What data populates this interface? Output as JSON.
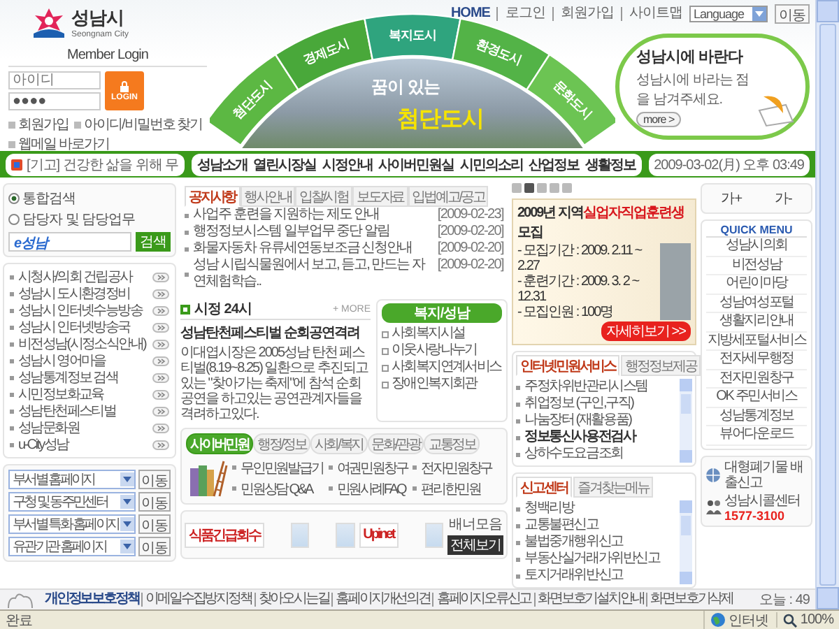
{
  "header": {
    "logo": {
      "name": "성남시",
      "subtitle": "Seongnam City"
    },
    "top_links": [
      "HOME",
      "로그인",
      "회원가입",
      "사이트맵"
    ],
    "language_select": {
      "value": "Language"
    },
    "go_button": "이동"
  },
  "login": {
    "title": "Member Login",
    "id_field": {
      "placeholder": "아이디"
    },
    "password_field": {
      "value": "●●●●"
    },
    "button": "LOGIN",
    "links": [
      "회원가입",
      "아이디/비밀번호 찾기",
      "웹메일 바로가기"
    ]
  },
  "hero": {
    "segments": [
      "첨단도시",
      "경제도시",
      "복지도시",
      "환경도시",
      "문화도시"
    ],
    "slogan": "꿈이 있는",
    "slogan_highlight": "첨단도시"
  },
  "suggestion": {
    "title": "성남시에 바란다",
    "text": "성남시에 바라는 점을 남겨주세요.",
    "button": "more >"
  },
  "nav": {
    "ticker": "[기고] 건강한 삶을 위해 무",
    "menu": [
      "성남소개",
      "열린시장실",
      "시정안내",
      "사이버민원실",
      "시민의소리",
      "산업정보",
      "생활정보"
    ],
    "datetime": "2009-03-02(月) 오후 03:49"
  },
  "search": {
    "options": [
      {
        "label": "통합검색",
        "selected": true
      },
      {
        "label": "담당자 및 담당업무",
        "selected": false
      }
    ],
    "field_logo": "e성남",
    "button": "검색"
  },
  "site_links": [
    "시청사/의회 건립공사",
    "성남시 도시환경정비",
    "성남시 인터넷수능방송",
    "성남시 인터넷방송국",
    "비전성남(시정소식안내)",
    "성남시 영어마을",
    "성남통계정보 검색",
    "시민정보화교육",
    "성남탄천페스티벌",
    "성남문화원",
    "u-City성남"
  ],
  "homepage_selects": [
    {
      "value": "부서별 홈페이지",
      "button": "이동"
    },
    {
      "value": "구청 및 동주민센터",
      "button": "이동"
    },
    {
      "value": "부서별 특화 홈페이지",
      "button": "이동"
    },
    {
      "value": "유관기관 홈페이지",
      "button": "이동"
    }
  ],
  "notices": {
    "tabs": [
      {
        "label": "공지사항",
        "selected": true
      },
      {
        "label": "행사안내",
        "selected": false
      },
      {
        "label": "입찰/시험",
        "selected": false
      },
      {
        "label": "보도자료",
        "selected": false
      },
      {
        "label": "입법예고/공고",
        "selected": false
      }
    ],
    "items": [
      {
        "title": "사업주 훈련을 지원하는 제도 안내",
        "date": "[2009-02-23]"
      },
      {
        "title": "행정정보시스템 일부업무 중단 알림",
        "date": "[2009-02-20]"
      },
      {
        "title": "화물자동차 유류세연동보조금 신청안내",
        "date": "[2009-02-20]"
      },
      {
        "title": "성남 시립식물원에서 보고, 듣고, 만드는 자연체험학습..",
        "date": "[2009-02-20]"
      }
    ]
  },
  "city_24": {
    "title": "시정 24시",
    "more": "+ MORE",
    "headline": "성남탄천페스티벌 순회공연격려",
    "body": "이대엽시장은 2005성남 탄천 페스티벌(8.19~8.25) 일환으로 추진되고있는 \"찾아가는 축제\"에 참석 순회공연을 하고있는 공연관계자들을 격려하고있다."
  },
  "welfare": {
    "title": "복지/성남",
    "items": [
      "사회복지시설",
      "이웃사랑나누기",
      "사회복지연계서비스",
      "장애인복지회관"
    ]
  },
  "civil": {
    "tabs": [
      {
        "label": "사이버민원",
        "selected": true
      },
      {
        "label": "행정/정보",
        "selected": false
      },
      {
        "label": "사회/복지",
        "selected": false
      },
      {
        "label": "문화/관광",
        "selected": false
      },
      {
        "label": "교통정보",
        "selected": false
      }
    ],
    "links": [
      "무인민원발급기",
      "여권민원창구",
      "전자민원창구",
      "민원상담 Q&A",
      "민원사례FAQ",
      "편리한민원"
    ]
  },
  "banners": {
    "items": [
      {
        "kind": "text",
        "text": "식품긴급회수"
      },
      {
        "kind": "logo"
      },
      {
        "kind": "logo"
      },
      {
        "kind": "text",
        "text": "Upinet"
      },
      {
        "kind": "logo"
      }
    ],
    "label": "배너모음",
    "button": "전체보기"
  },
  "promo_banner": {
    "dots": [
      {
        "selected": false
      },
      {
        "selected": true
      },
      {
        "selected": false
      },
      {
        "selected": false
      },
      {
        "selected": false
      }
    ],
    "title": "2009년 지역**실업자직업훈련생** 모집",
    "lines": [
      "- 모집기간 : 2009. 2.11 ~ 2.27",
      "- 훈련기간 : 2009. 3. 2 ~ 12.31",
      "- 모집인원 : 100명"
    ],
    "button": "자세히보기 >>"
  },
  "internet_service": {
    "tabs": [
      {
        "label": "인터넷민원서비스",
        "selected": true
      },
      {
        "label": "행정정보제공",
        "selected": false
      }
    ],
    "items": [
      {
        "label": "주정차위반관리시스템",
        "emphasized": false
      },
      {
        "label": "취업정보 (구인,구직)",
        "emphasized": false
      },
      {
        "label": "나눔장터 (재활용품)",
        "emphasized": false
      },
      {
        "label": "정보통신사용전검사",
        "emphasized": true
      },
      {
        "label": "상하수도요금조회",
        "emphasized": false
      }
    ]
  },
  "report_center": {
    "tabs": [
      {
        "label": "신고센터",
        "selected": true
      },
      {
        "label": "즐겨찾는메뉴",
        "selected": false
      }
    ],
    "items": [
      {
        "label": "청백리방",
        "emphasized": false
      },
      {
        "label": "교통불편신고",
        "emphasized": false
      },
      {
        "label": "불법중개행위신고",
        "emphasized": false
      },
      {
        "label": "부동산실거래가위반신고",
        "emphasized": false
      },
      {
        "label": "토지거래위반신고",
        "emphasized": false
      }
    ]
  },
  "font_size_buttons": [
    "가+",
    "가-"
  ],
  "quick_menu": {
    "title": "QUICK MENU",
    "items": [
      "성남시의회",
      "비전성남",
      "어린이마당",
      "성남여성포털",
      "생활지리안내",
      "지방세포털서비스",
      "전자세무행정",
      "전자민원창구",
      "OK 주민서비스",
      "성남통계정보",
      "뷰어다운로드"
    ]
  },
  "quick_links": [
    {
      "kind": "waste",
      "text": "대형폐기물 배출신고"
    },
    {
      "kind": "call",
      "text": "성남시콜센터",
      "phone": "1577-3100"
    }
  ],
  "footer": {
    "links": [
      "개인정보보호정책",
      "이메일수집방지정책",
      "찾아오시는길",
      "홈페이지개선의견",
      "홈페이지오류신고",
      "화면보호기설치안내",
      "화면보호기삭제"
    ],
    "visitors": "오늘 : 49"
  },
  "status_bar": {
    "text": "완료",
    "zone": "인터넷",
    "zoom": "100%"
  }
}
